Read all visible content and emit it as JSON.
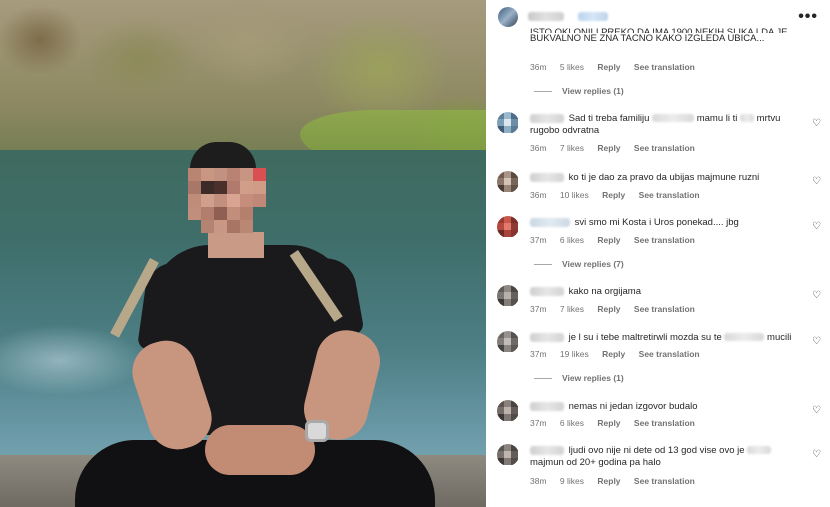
{
  "post": {
    "more_icon": "more-horizontal-icon",
    "header_more_label": "•••"
  },
  "top_comment": {
    "line1_cut": "ISTO OKLONILI PREKO DA IMA 1900 NEKIH SLIKA I DA JE",
    "line2": "BUKVALNO NE ZNA TACNO KAKO IZGLEDA UBICA...",
    "time": "36m",
    "likes": "5 likes",
    "reply": "Reply",
    "translate": "See translation",
    "view_replies": "View replies (1)"
  },
  "comments": [
    {
      "part1": "Sad ti treba familiju",
      "part2": "mamu li ti",
      "part3": "mrtvu rugobo odvratna",
      "time": "36m",
      "likes": "7 likes",
      "reply": "Reply",
      "translate": "See translation"
    },
    {
      "part1": "ko ti je dao za pravo da ubijas majmune ruzni",
      "time": "36m",
      "likes": "10 likes",
      "reply": "Reply",
      "translate": "See translation"
    },
    {
      "part1": "svi smo mi Kosta i Uros ponekad.... jbg",
      "time": "37m",
      "likes": "6 likes",
      "reply": "Reply",
      "translate": "See translation",
      "view_replies": "View replies (7)"
    },
    {
      "part1": "kako na orgijama",
      "time": "37m",
      "likes": "7 likes",
      "reply": "Reply",
      "translate": "See translation"
    },
    {
      "part1": "je l su i tebe maltretirwli mozda su te",
      "part2": "mucili",
      "time": "37m",
      "likes": "19 likes",
      "reply": "Reply",
      "translate": "See translation",
      "view_replies": "View replies (1)"
    },
    {
      "part1": "nemas ni jedan izgovor budalo",
      "time": "37m",
      "likes": "6 likes",
      "reply": "Reply",
      "translate": "See translation"
    },
    {
      "part1": "ljudi ovo nije ni dete od 13 god vise ovo je",
      "part2": "majmun od 20+ godina pa halo",
      "time": "38m",
      "likes": "9 likes",
      "reply": "Reply",
      "translate": "See translation"
    }
  ],
  "icons": {
    "heart": "heart-outline-icon",
    "heart_glyph": "♡"
  }
}
